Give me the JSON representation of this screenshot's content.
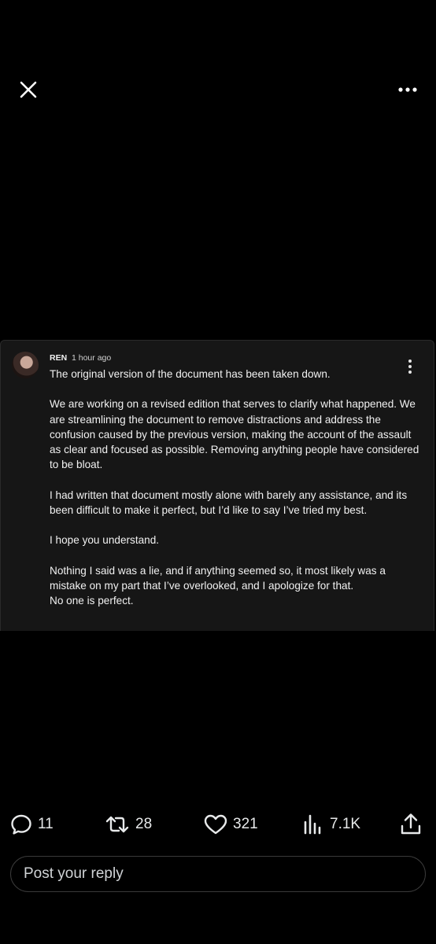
{
  "comment": {
    "author": "REN",
    "time": "1 hour ago",
    "paragraphs": [
      "The original version of the document has been taken down.",
      "We are working on a revised edition that serves to clarify what happened. We are streamlining the document to remove distractions and address the confusion caused by the previous version, making the account of the assault as clear and focused as possible. Removing anything people have considered to be bloat.",
      "I had written that document mostly alone with barely any assistance, and its been difficult to make it perfect, but I’d like to say I’ve tried my best.",
      "I hope you understand.",
      "Nothing I said was a lie, and if anything seemed so, it most likely was a mistake on my part that I’ve overlooked, and I apologize for that.\nNo one is perfect."
    ]
  },
  "actions": {
    "replies": "11",
    "reposts": "28",
    "likes": "321",
    "views": "7.1K"
  },
  "reply_box": {
    "placeholder": "Post your reply"
  },
  "icons": {
    "close": "close-icon",
    "more": "more-horizontal-icon",
    "kebab": "more-vertical-icon",
    "reply": "reply-icon",
    "repost": "repost-icon",
    "like": "heart-icon",
    "views": "views-icon",
    "share": "share-icon"
  }
}
